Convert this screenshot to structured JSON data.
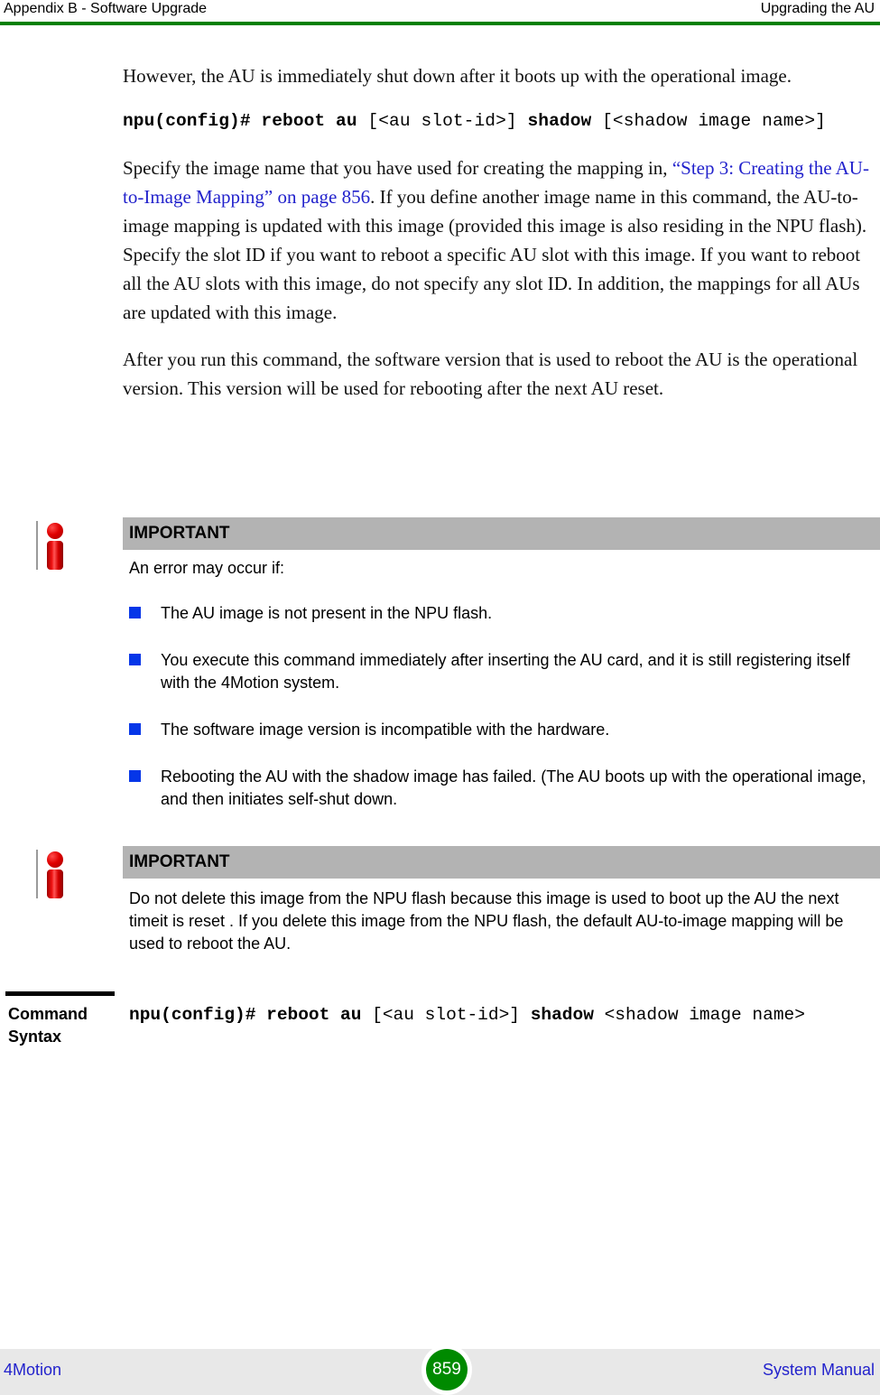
{
  "header": {
    "left": "Appendix B - Software Upgrade",
    "right": "Upgrading the AU",
    "rule_color": "#008000"
  },
  "body": {
    "paragraph_1": "However, the AU is immediately shut down after it boots up with the operational image.",
    "command_1": {
      "bold_1": "npu(config)# reboot au",
      "plain_1": " [<au slot-id>] ",
      "bold_2": "shadow",
      "plain_2": " [<shadow image name>]"
    },
    "paragraph_2": {
      "before_link": "Specify the image name that you have used for creating the mapping in, ",
      "link": "“Step 3: Creating the AU-to-Image Mapping” on page 856",
      "after_link": ". If you define another image name in this command, the AU-to-image mapping is updated with this image (provided this image is also residing in the NPU flash). Specify the slot ID if you want to reboot a specific AU slot with this image. If you want to reboot all the AU slots with this image, do not specify any slot ID. In addition, the mappings for all AUs are updated with this image.",
      "link_color": "#2222cc"
    },
    "paragraph_3": "After you run this command, the software version that is used to reboot the AU is the operational version. This version will be used for rebooting after the next AU reset."
  },
  "callout_1": {
    "icon": "important-info-icon",
    "title": "IMPORTANT",
    "lead": "An error may occur if:",
    "bullet_color": "#0536e8",
    "bullets": [
      "The AU image is not present in the NPU flash.",
      "You execute this command immediately after inserting the AU card, and it is still registering itself with the 4Motion system.",
      "The software image version is incompatible with the hardware.",
      "Rebooting the AU with the shadow image has failed. (The AU boots up with the operational image, and then initiates self-shut down."
    ]
  },
  "callout_2": {
    "icon": "important-info-icon",
    "title": "IMPORTANT",
    "text": "Do not delete this image from the NPU flash because this image is used to boot up the AU the next timeit is reset . If you delete this image from the NPU flash, the default AU-to-image mapping will be used to reboot the AU."
  },
  "command_syntax": {
    "label": "Command Syntax",
    "code": {
      "bold_1": "npu(config)# reboot au",
      "plain_1": " [<au slot-id>] ",
      "bold_2": "shadow",
      "plain_2": " <shadow image name>"
    }
  },
  "footer": {
    "left": "4Motion",
    "page_number": "859",
    "right": "System Manual",
    "link_color": "#2222cc",
    "badge_color": "#008a00"
  }
}
